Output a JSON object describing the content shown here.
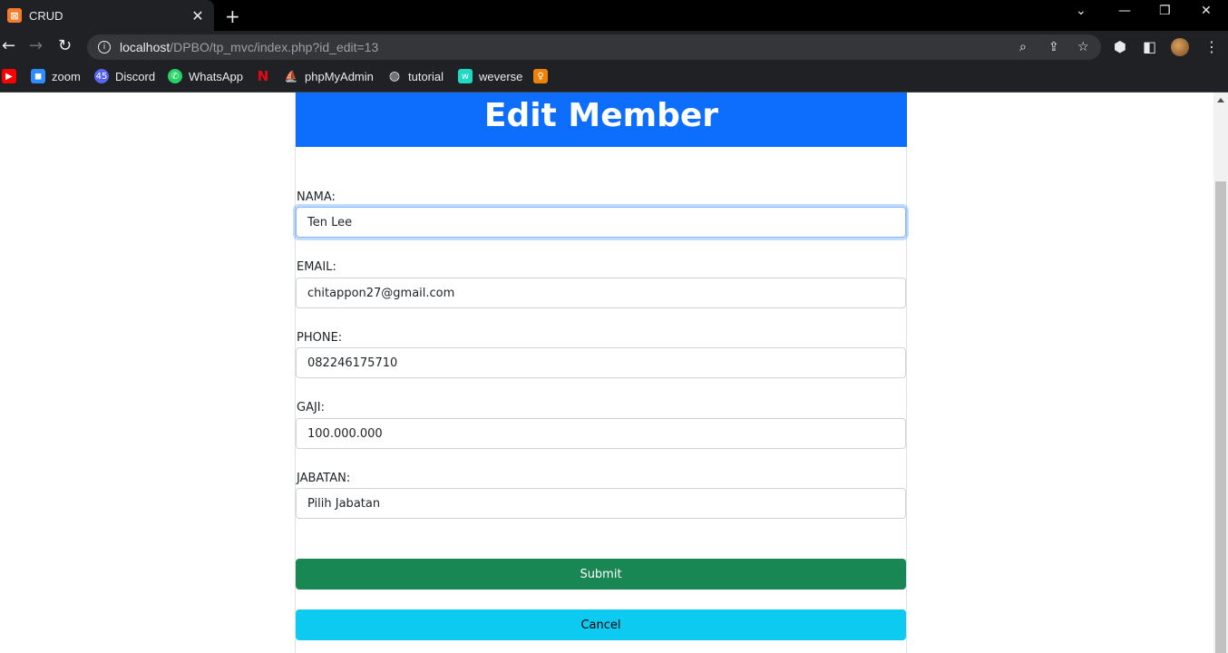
{
  "browser": {
    "tab_title": "CRUD",
    "tab_close": "✕",
    "new_tab": "+",
    "url_host": "localhost",
    "url_path": "/DPBO/tp_mvc/index.php?id_edit=13",
    "bookmarks": [
      {
        "label": "",
        "icon": "youtube-icon",
        "color": "#ff0000"
      },
      {
        "label": "zoom",
        "icon": "zoom-icon",
        "color": "#2d8cff"
      },
      {
        "label": "Discord",
        "icon": "discord-icon",
        "color": "#5865f2",
        "badge": "45"
      },
      {
        "label": "WhatsApp",
        "icon": "whatsapp-icon",
        "color": "#25d366"
      },
      {
        "label": "",
        "icon": "netflix-icon",
        "color": "#e50914"
      },
      {
        "label": "phpMyAdmin",
        "icon": "phpmyadmin-icon",
        "color": "#f89c0e"
      },
      {
        "label": "tutorial",
        "icon": "globe-icon",
        "color": "#e8eaed"
      },
      {
        "label": "weverse",
        "icon": "weverse-icon",
        "color": "#1ed9c3"
      },
      {
        "label": "",
        "icon": "odnoklassniki-icon",
        "color": "#ee8208"
      }
    ]
  },
  "form": {
    "title": "Edit Member",
    "fields": [
      {
        "label": "NAMA:",
        "value": "Ten Lee"
      },
      {
        "label": "EMAIL:",
        "value": "chitappon27@gmail.com"
      },
      {
        "label": "PHONE:",
        "value": "082246175710"
      },
      {
        "label": "GAJI:",
        "value": "100.000.000"
      },
      {
        "label": "JABATAN:",
        "value": "Pilih Jabatan"
      }
    ],
    "submit_label": "Submit",
    "cancel_label": "Cancel"
  },
  "colors": {
    "header": "#0d6efd",
    "submit": "#198754",
    "cancel": "#0dcaf0"
  }
}
